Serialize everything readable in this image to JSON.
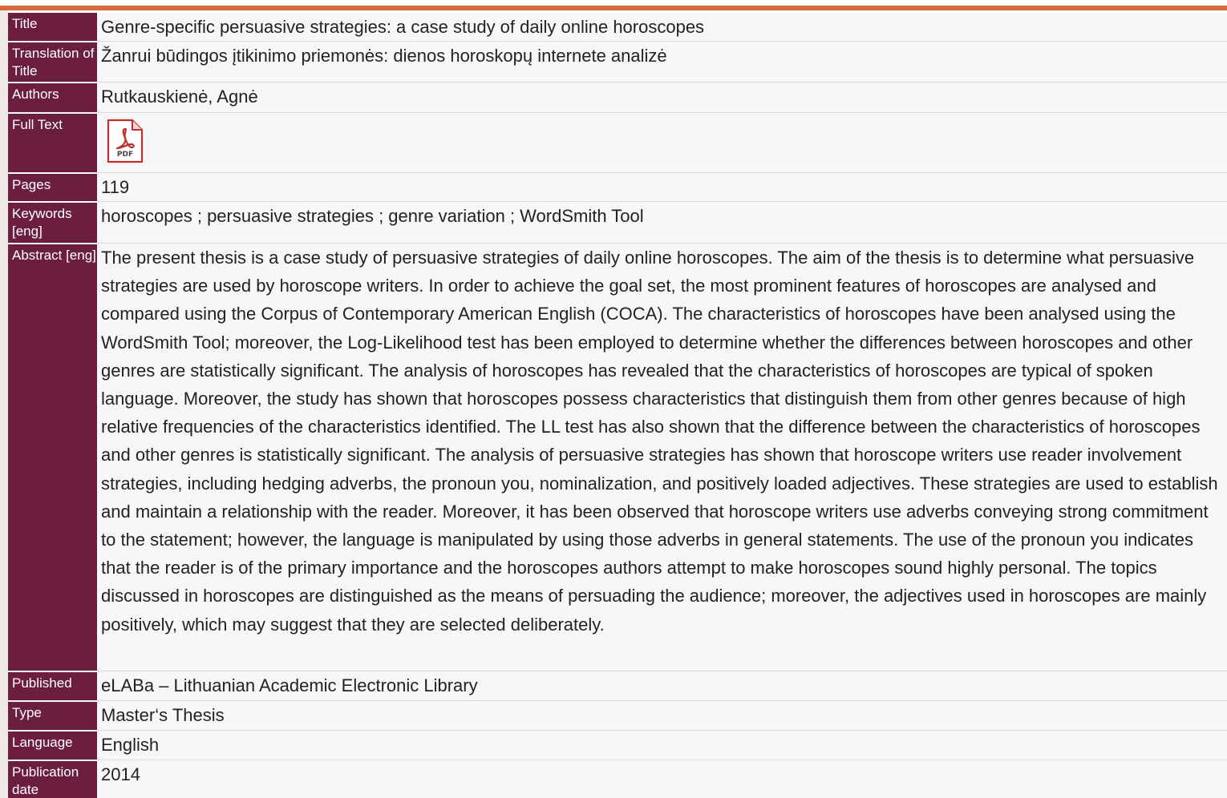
{
  "accent_color": "#d9683b",
  "label_bg": "#6b1e3e",
  "rows": {
    "title": {
      "label": "Title",
      "value": "Genre-specific persuasive strategies: a case study of daily online horoscopes"
    },
    "translation": {
      "label": "Translation of Title",
      "value": "Žanrui būdingos įtikinimo priemonės: dienos horoskopų internete analizė"
    },
    "authors": {
      "label": "Authors",
      "value": "Rutkauskienė, Agnė"
    },
    "fulltext": {
      "label": "Full Text",
      "icon": "pdf-file-icon",
      "icon_text": "PDF"
    },
    "pages": {
      "label": "Pages",
      "value": "119"
    },
    "keywords": {
      "label": "Keywords [eng]",
      "value": "horoscopes ; persuasive strategies ; genre variation ; WordSmith Tool"
    },
    "abstract": {
      "label": "Abstract [eng]",
      "value": "The present thesis is a case study of persuasive strategies of daily online horoscopes. The aim of the thesis is to determine what persuasive strategies are used by horoscope writers. In order to achieve the goal set, the most prominent features of horoscopes are analysed and compared using the Corpus of Contemporary American English (COCA). The characteristics of horoscopes have been analysed using the WordSmith Tool; moreover, the Log-Likelihood test has been employed to determine whether the differences between horoscopes and other genres are statistically significant. The analysis of horoscopes has revealed that the characteristics of horoscopes are typical of spoken language. Moreover, the study has shown that horoscopes possess characteristics that distinguish them from other genres because of high relative frequencies of the characteristics identified. The LL test has also shown that the difference between the characteristics of horoscopes and other genres is statistically significant. The analysis of persuasive strategies has shown that horoscope writers use reader involvement strategies, including hedging adverbs, the pronoun you, nominalization, and positively loaded adjectives. These strategies are used to establish and maintain a relationship with the reader. Moreover, it has been observed that horoscope writers use adverbs conveying strong commitment to the statement; however, the language is manipulated by using those adverbs in general statements. The use of the pronoun you indicates that the reader is of the primary importance and the horoscopes authors attempt to make horoscopes sound highly personal. The topics discussed in horoscopes are distinguished as the means of persuading the audience; moreover, the adjectives used in horoscopes are mainly positively, which may suggest that they are selected deliberately."
    },
    "published": {
      "label": "Published",
      "value": "eLABa – Lithuanian Academic Electronic Library"
    },
    "type": {
      "label": "Type",
      "value": "Master‘s Thesis"
    },
    "language": {
      "label": "Language",
      "value": "English"
    },
    "pubdate": {
      "label": "Publication date",
      "value": "2014"
    }
  }
}
